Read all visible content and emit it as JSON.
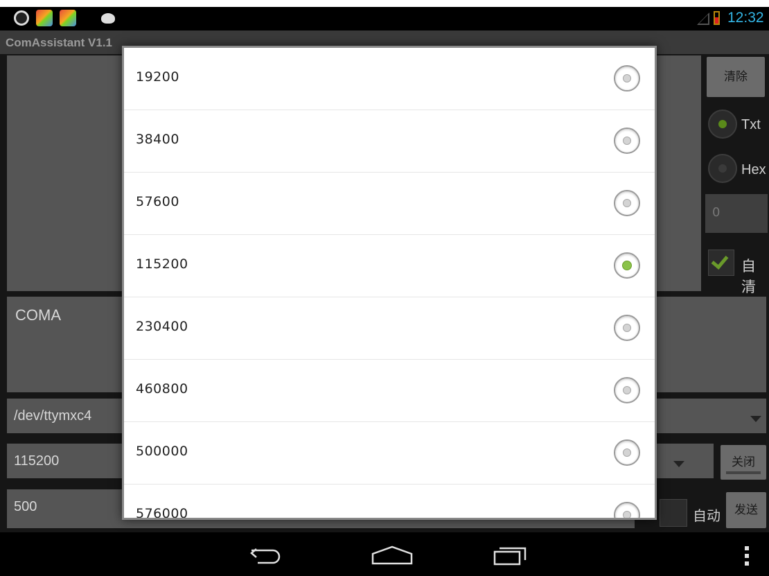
{
  "status_bar": {
    "time": "12:32",
    "icons": [
      "alarm-icon",
      "app-icon",
      "app-icon",
      "android-icon",
      "signal-icon",
      "battery-icon"
    ]
  },
  "app": {
    "title": "ComAssistant V1.1"
  },
  "main": {
    "clear_label": "清除",
    "radio_txt_label": "Txt",
    "radio_hex_label": "Hex",
    "count_value": "0",
    "autoclear_label": "自清",
    "send_text": "COMA",
    "port_value": "/dev/ttymxc4",
    "baud_value": "115200",
    "interval_value": "500",
    "close_label": "关闭",
    "auto_label": "自动",
    "send_label": "发送"
  },
  "dialog": {
    "options": [
      "19200",
      "38400",
      "57600",
      "115200",
      "230400",
      "460800",
      "500000",
      "576000"
    ],
    "selected": "115200"
  },
  "colors": {
    "accent_time": "#33b5e5",
    "radio_selected": "#8bc34a"
  }
}
